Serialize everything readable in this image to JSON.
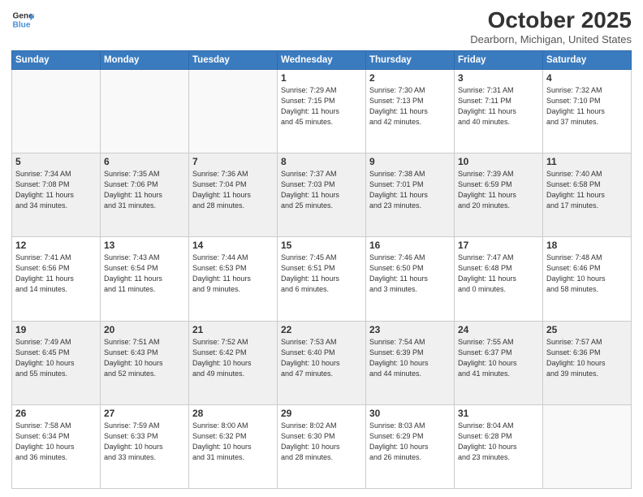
{
  "logo": {
    "line1": "General",
    "line2": "Blue"
  },
  "header": {
    "month": "October 2025",
    "location": "Dearborn, Michigan, United States"
  },
  "days_of_week": [
    "Sunday",
    "Monday",
    "Tuesday",
    "Wednesday",
    "Thursday",
    "Friday",
    "Saturday"
  ],
  "weeks": [
    [
      {
        "day": "",
        "info": ""
      },
      {
        "day": "",
        "info": ""
      },
      {
        "day": "",
        "info": ""
      },
      {
        "day": "1",
        "info": "Sunrise: 7:29 AM\nSunset: 7:15 PM\nDaylight: 11 hours\nand 45 minutes."
      },
      {
        "day": "2",
        "info": "Sunrise: 7:30 AM\nSunset: 7:13 PM\nDaylight: 11 hours\nand 42 minutes."
      },
      {
        "day": "3",
        "info": "Sunrise: 7:31 AM\nSunset: 7:11 PM\nDaylight: 11 hours\nand 40 minutes."
      },
      {
        "day": "4",
        "info": "Sunrise: 7:32 AM\nSunset: 7:10 PM\nDaylight: 11 hours\nand 37 minutes."
      }
    ],
    [
      {
        "day": "5",
        "info": "Sunrise: 7:34 AM\nSunset: 7:08 PM\nDaylight: 11 hours\nand 34 minutes."
      },
      {
        "day": "6",
        "info": "Sunrise: 7:35 AM\nSunset: 7:06 PM\nDaylight: 11 hours\nand 31 minutes."
      },
      {
        "day": "7",
        "info": "Sunrise: 7:36 AM\nSunset: 7:04 PM\nDaylight: 11 hours\nand 28 minutes."
      },
      {
        "day": "8",
        "info": "Sunrise: 7:37 AM\nSunset: 7:03 PM\nDaylight: 11 hours\nand 25 minutes."
      },
      {
        "day": "9",
        "info": "Sunrise: 7:38 AM\nSunset: 7:01 PM\nDaylight: 11 hours\nand 23 minutes."
      },
      {
        "day": "10",
        "info": "Sunrise: 7:39 AM\nSunset: 6:59 PM\nDaylight: 11 hours\nand 20 minutes."
      },
      {
        "day": "11",
        "info": "Sunrise: 7:40 AM\nSunset: 6:58 PM\nDaylight: 11 hours\nand 17 minutes."
      }
    ],
    [
      {
        "day": "12",
        "info": "Sunrise: 7:41 AM\nSunset: 6:56 PM\nDaylight: 11 hours\nand 14 minutes."
      },
      {
        "day": "13",
        "info": "Sunrise: 7:43 AM\nSunset: 6:54 PM\nDaylight: 11 hours\nand 11 minutes."
      },
      {
        "day": "14",
        "info": "Sunrise: 7:44 AM\nSunset: 6:53 PM\nDaylight: 11 hours\nand 9 minutes."
      },
      {
        "day": "15",
        "info": "Sunrise: 7:45 AM\nSunset: 6:51 PM\nDaylight: 11 hours\nand 6 minutes."
      },
      {
        "day": "16",
        "info": "Sunrise: 7:46 AM\nSunset: 6:50 PM\nDaylight: 11 hours\nand 3 minutes."
      },
      {
        "day": "17",
        "info": "Sunrise: 7:47 AM\nSunset: 6:48 PM\nDaylight: 11 hours\nand 0 minutes."
      },
      {
        "day": "18",
        "info": "Sunrise: 7:48 AM\nSunset: 6:46 PM\nDaylight: 10 hours\nand 58 minutes."
      }
    ],
    [
      {
        "day": "19",
        "info": "Sunrise: 7:49 AM\nSunset: 6:45 PM\nDaylight: 10 hours\nand 55 minutes."
      },
      {
        "day": "20",
        "info": "Sunrise: 7:51 AM\nSunset: 6:43 PM\nDaylight: 10 hours\nand 52 minutes."
      },
      {
        "day": "21",
        "info": "Sunrise: 7:52 AM\nSunset: 6:42 PM\nDaylight: 10 hours\nand 49 minutes."
      },
      {
        "day": "22",
        "info": "Sunrise: 7:53 AM\nSunset: 6:40 PM\nDaylight: 10 hours\nand 47 minutes."
      },
      {
        "day": "23",
        "info": "Sunrise: 7:54 AM\nSunset: 6:39 PM\nDaylight: 10 hours\nand 44 minutes."
      },
      {
        "day": "24",
        "info": "Sunrise: 7:55 AM\nSunset: 6:37 PM\nDaylight: 10 hours\nand 41 minutes."
      },
      {
        "day": "25",
        "info": "Sunrise: 7:57 AM\nSunset: 6:36 PM\nDaylight: 10 hours\nand 39 minutes."
      }
    ],
    [
      {
        "day": "26",
        "info": "Sunrise: 7:58 AM\nSunset: 6:34 PM\nDaylight: 10 hours\nand 36 minutes."
      },
      {
        "day": "27",
        "info": "Sunrise: 7:59 AM\nSunset: 6:33 PM\nDaylight: 10 hours\nand 33 minutes."
      },
      {
        "day": "28",
        "info": "Sunrise: 8:00 AM\nSunset: 6:32 PM\nDaylight: 10 hours\nand 31 minutes."
      },
      {
        "day": "29",
        "info": "Sunrise: 8:02 AM\nSunset: 6:30 PM\nDaylight: 10 hours\nand 28 minutes."
      },
      {
        "day": "30",
        "info": "Sunrise: 8:03 AM\nSunset: 6:29 PM\nDaylight: 10 hours\nand 26 minutes."
      },
      {
        "day": "31",
        "info": "Sunrise: 8:04 AM\nSunset: 6:28 PM\nDaylight: 10 hours\nand 23 minutes."
      },
      {
        "day": "",
        "info": ""
      }
    ]
  ]
}
